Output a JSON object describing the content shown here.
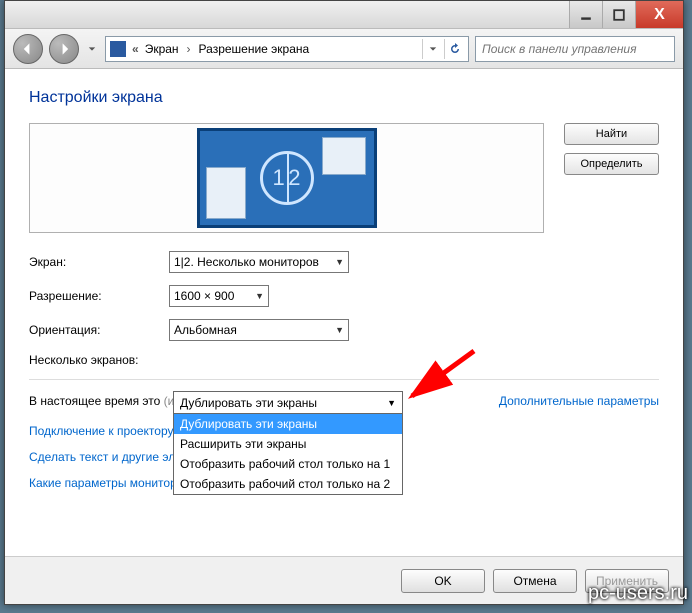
{
  "titlebar": {
    "close_glyph": "X"
  },
  "breadcrumb": {
    "item1": "Экран",
    "item2": "Разрешение экрана"
  },
  "search": {
    "placeholder": "Поиск в панели управления"
  },
  "page_title": "Настройки экрана",
  "monitors": {
    "combined": "1 2"
  },
  "side_buttons": {
    "find": "Найти",
    "identify": "Определить"
  },
  "form": {
    "screen_label": "Экран:",
    "screen_value": "1|2. Несколько мониторов",
    "resolution_label": "Разрешение:",
    "resolution_value": "1600 × 900",
    "orientation_label": "Ориентация:",
    "orientation_value": "Альбомная",
    "multiple_label": "Несколько экранов:",
    "multiple_value": "Дублировать эти экраны"
  },
  "dropdown": {
    "options": [
      "Дублировать эти экраны",
      "Расширить эти экраны",
      "Отобразить рабочий стол только на 1",
      "Отобразить рабочий стол только на 2"
    ]
  },
  "status": {
    "text": "В настоящее время это ",
    "text_obscured": "(или нажмите клавишу     и коснитесь P)",
    "advanced_link": "Дополнительные параметры"
  },
  "links": {
    "projector": "Подключение к проектору",
    "text_size": "Сделать текст и другие элементы больше или меньше",
    "which_settings": "Какие параметры монитора следует выбрать?"
  },
  "buttons": {
    "ok": "OK",
    "cancel": "Отмена",
    "apply": "Применить"
  },
  "watermark": "pc-users.ru"
}
